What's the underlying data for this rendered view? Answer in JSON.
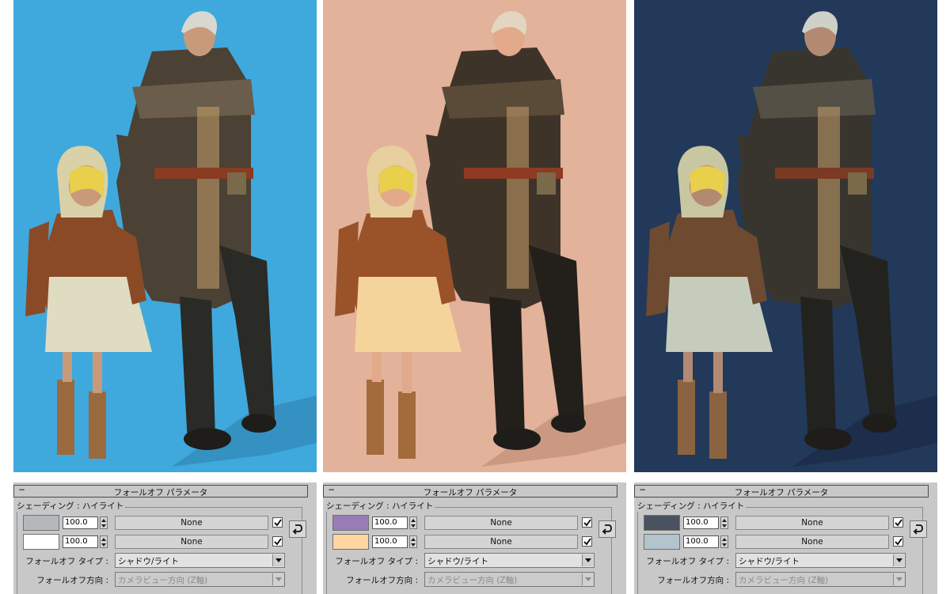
{
  "panels": [
    {
      "background": "#3fa9dd",
      "shadow_color": "#2d7dab",
      "rollout": {
        "title": "フォールオフ パラメータ",
        "group_label": "シェーディング : ハイライト",
        "rows": [
          {
            "swatch": "#b5b8ba",
            "value": "100.0",
            "map": "None",
            "checked": true
          },
          {
            "swatch": "#ffffff",
            "value": "100.0",
            "map": "None",
            "checked": true
          }
        ],
        "falloff_type_label": "フォールオフ タイプ :",
        "falloff_type_value": "シャドウ/ライト",
        "falloff_dir_label": "フォールオフ方向 :",
        "falloff_dir_value": "カメラビュー方向 (Z軸)"
      }
    },
    {
      "background": "#e3b29a",
      "shadow_color": "#b88570",
      "rollout": {
        "title": "フォールオフ パラメータ",
        "group_label": "シェーディング : ハイライト",
        "rows": [
          {
            "swatch": "#9a7cb8",
            "value": "100.0",
            "map": "None",
            "checked": true
          },
          {
            "swatch": "#ffd6a2",
            "value": "100.0",
            "map": "None",
            "checked": true
          }
        ],
        "falloff_type_label": "フォールオフ タイプ :",
        "falloff_type_value": "シャドウ/ライト",
        "falloff_dir_label": "フォールオフ方向 :",
        "falloff_dir_value": "カメラビュー方向 (Z軸)"
      }
    },
    {
      "background": "#22395a",
      "shadow_color": "#172740",
      "rollout": {
        "title": "フォールオフ パラメータ",
        "group_label": "シェーディング : ハイライト",
        "rows": [
          {
            "swatch": "#4a5260",
            "value": "100.0",
            "map": "None",
            "checked": true
          },
          {
            "swatch": "#b4c4cc",
            "value": "100.0",
            "map": "None",
            "checked": true
          }
        ],
        "falloff_type_label": "フォールオフ タイプ :",
        "falloff_type_value": "シャドウ/ライト",
        "falloff_dir_label": "フォールオフ方向 :",
        "falloff_dir_value": "カメラビュー方向 (Z軸)"
      }
    }
  ],
  "icons": {
    "collapse": "minus-icon",
    "swap": "swap-arrow-icon",
    "check": "check-icon",
    "dropdown": "chevron-down-icon"
  }
}
